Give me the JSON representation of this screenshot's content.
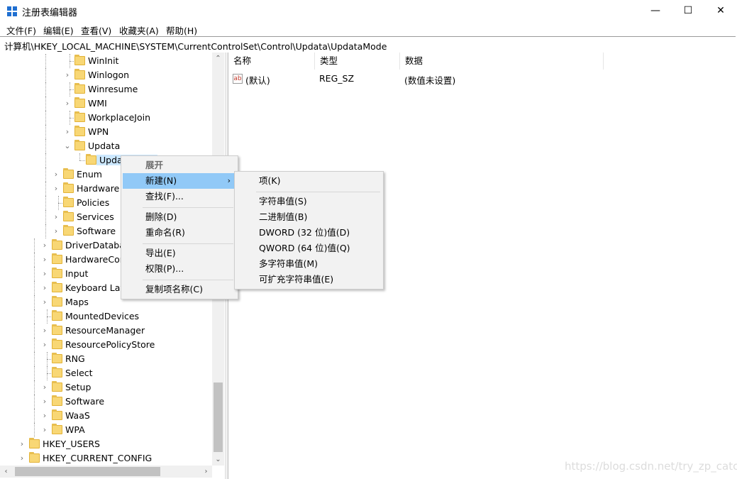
{
  "window": {
    "title": "注册表编辑器",
    "minimize_glyph": "—",
    "maximize_glyph": "☐",
    "close_glyph": "✕"
  },
  "menu": [
    "文件(F)",
    "编辑(E)",
    "查看(V)",
    "收藏夹(A)",
    "帮助(H)"
  ],
  "address": "计算机\\HKEY_LOCAL_MACHINE\\SYSTEM\\CurrentControlSet\\Control\\Updata\\UpdataMode",
  "tree": [
    {
      "label": "WinInit",
      "chevron": ""
    },
    {
      "label": "Winlogon",
      "chevron": "›"
    },
    {
      "label": "Winresume",
      "chevron": ""
    },
    {
      "label": "WMI",
      "chevron": "›"
    },
    {
      "label": "WorkplaceJoin",
      "chevron": ""
    },
    {
      "label": "WPN",
      "chevron": "›"
    },
    {
      "label": "Updata",
      "chevron": "⌄"
    },
    {
      "label": "Upda",
      "chevron": ""
    },
    {
      "label": "Enum",
      "chevron": "›"
    },
    {
      "label": "Hardware",
      "chevron": "›"
    },
    {
      "label": "Policies",
      "chevron": ""
    },
    {
      "label": "Services",
      "chevron": "›"
    },
    {
      "label": "Software",
      "chevron": "›"
    },
    {
      "label": "DriverDataba",
      "chevron": "›"
    },
    {
      "label": "HardwareCor",
      "chevron": "›"
    },
    {
      "label": "Input",
      "chevron": "›"
    },
    {
      "label": "Keyboard Lay",
      "chevron": "›"
    },
    {
      "label": "Maps",
      "chevron": "›"
    },
    {
      "label": "MountedDevices",
      "chevron": ""
    },
    {
      "label": "ResourceManager",
      "chevron": "›"
    },
    {
      "label": "ResourcePolicyStore",
      "chevron": "›"
    },
    {
      "label": "RNG",
      "chevron": ""
    },
    {
      "label": "Select",
      "chevron": ""
    },
    {
      "label": "Setup",
      "chevron": "›"
    },
    {
      "label": "Software",
      "chevron": "›"
    },
    {
      "label": "WaaS",
      "chevron": "›"
    },
    {
      "label": "WPA",
      "chevron": "›"
    },
    {
      "label": "HKEY_USERS",
      "chevron": "›"
    },
    {
      "label": "HKEY_CURRENT_CONFIG",
      "chevron": "›"
    }
  ],
  "columns": {
    "name": "名称",
    "type": "类型",
    "data": "数据"
  },
  "values": [
    {
      "icon": "ab",
      "name": "(默认)",
      "type": "REG_SZ",
      "data": "(数值未设置)"
    }
  ],
  "context_menu": {
    "items": [
      "展开",
      "新建(N)",
      "查找(F)...",
      "删除(D)",
      "重命名(R)",
      "导出(E)",
      "权限(P)...",
      "复制项名称(C)"
    ],
    "submenu_arrow": "›"
  },
  "submenu": {
    "items": [
      "项(K)",
      "字符串值(S)",
      "二进制值(B)",
      "DWORD (32 位)值(D)",
      "QWORD (64 位)值(Q)",
      "多字符串值(M)",
      "可扩充字符串值(E)"
    ]
  },
  "scroll": {
    "up": "⌃",
    "down": "⌄",
    "left": "‹",
    "right": "›"
  },
  "watermark": "https://blog.csdn.net/try_zp_catch",
  "colors": {
    "highlight": "#91c9f7",
    "folder": "#f8d775",
    "selection": "#cce8ff"
  }
}
